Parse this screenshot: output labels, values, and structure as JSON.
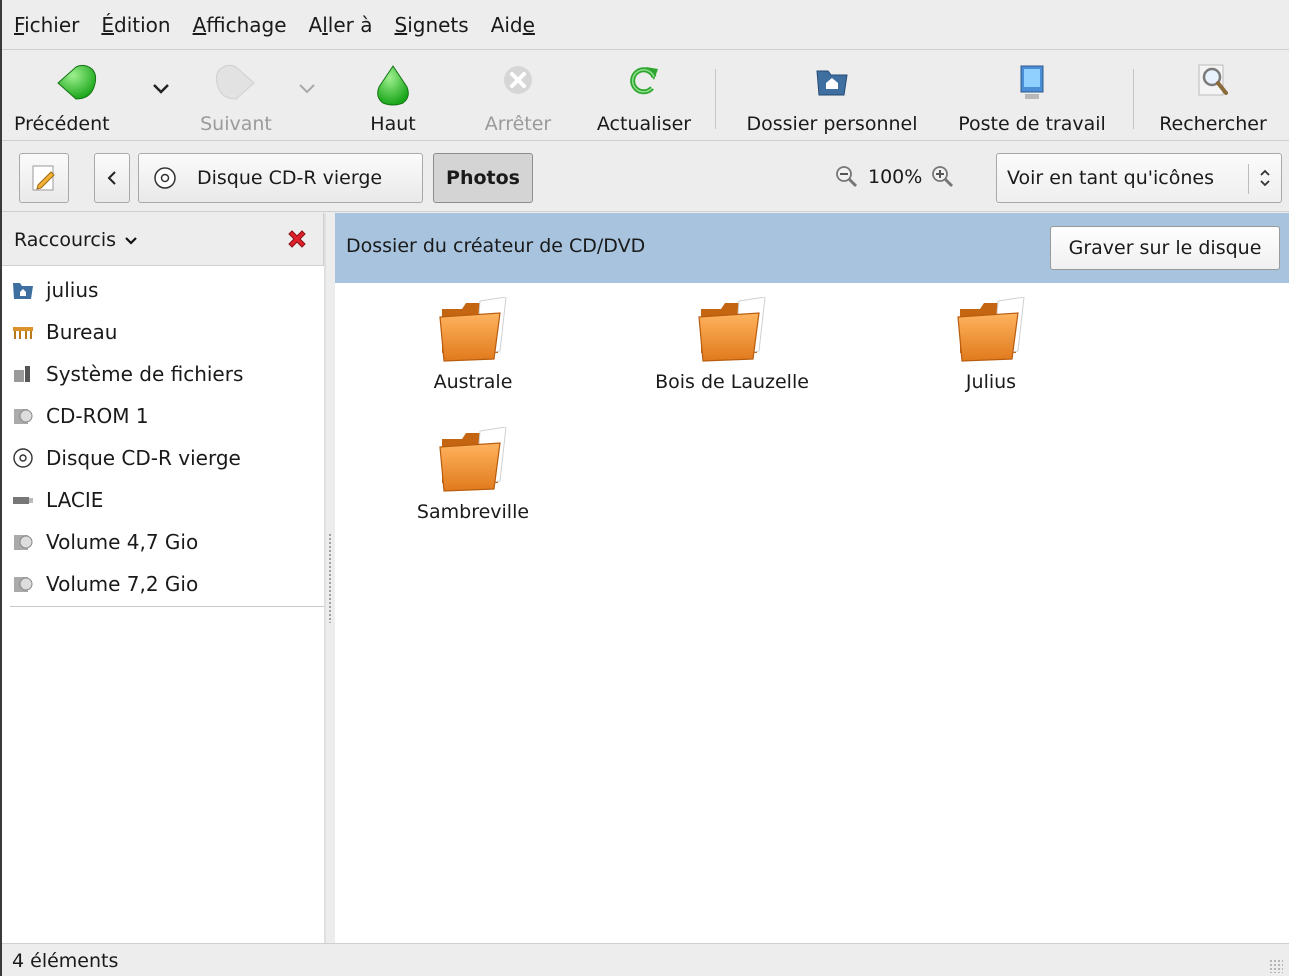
{
  "menubar": {
    "items": [
      {
        "prefix": "",
        "mnemonic": "F",
        "suffix": "ichier"
      },
      {
        "prefix": "",
        "mnemonic": "É",
        "suffix": "dition"
      },
      {
        "prefix": "",
        "mnemonic": "A",
        "suffix": "ffichage"
      },
      {
        "prefix": "A",
        "mnemonic": "l",
        "suffix": "ler à"
      },
      {
        "prefix": "",
        "mnemonic": "S",
        "suffix": "ignets"
      },
      {
        "prefix": "Aid",
        "mnemonic": "e",
        "suffix": ""
      }
    ]
  },
  "toolbar": {
    "back_label": "Précédent",
    "forward_label": "Suivant",
    "up_label": "Haut",
    "stop_label": "Arrêter",
    "reload_label": "Actualiser",
    "home_label": "Dossier personnel",
    "computer_label": "Poste de travail",
    "search_label": "Rechercher"
  },
  "locbar": {
    "path": [
      "Disque CD-R vierge",
      "Photos"
    ],
    "zoom": "100%",
    "view_mode": "Voir en tant qu'icônes"
  },
  "sidebar": {
    "title": "Raccourcis",
    "items": [
      {
        "label": "julius",
        "icon": "home-folder-icon"
      },
      {
        "label": "Bureau",
        "icon": "desktop-icon"
      },
      {
        "label": "Système de fichiers",
        "icon": "filesystem-icon"
      },
      {
        "label": "CD-ROM 1",
        "icon": "drive-icon"
      },
      {
        "label": "Disque CD-R vierge",
        "icon": "cd-icon"
      },
      {
        "label": "LACIE",
        "icon": "usb-drive-icon"
      },
      {
        "label": "Volume 4,7 Gio",
        "icon": "drive-icon"
      },
      {
        "label": "Volume 7,2 Gio",
        "icon": "drive-icon"
      }
    ]
  },
  "content": {
    "banner_text": "Dossier du créateur de CD/DVD",
    "burn_button": "Graver sur le disque",
    "folders": [
      "Australe",
      "Bois de Lauzelle",
      "Julius",
      "Sambreville"
    ]
  },
  "status": {
    "text": "4 éléments"
  },
  "colors": {
    "banner": "#a7c3de",
    "folder": "#f5a040",
    "back_green": "#3cc23c"
  }
}
